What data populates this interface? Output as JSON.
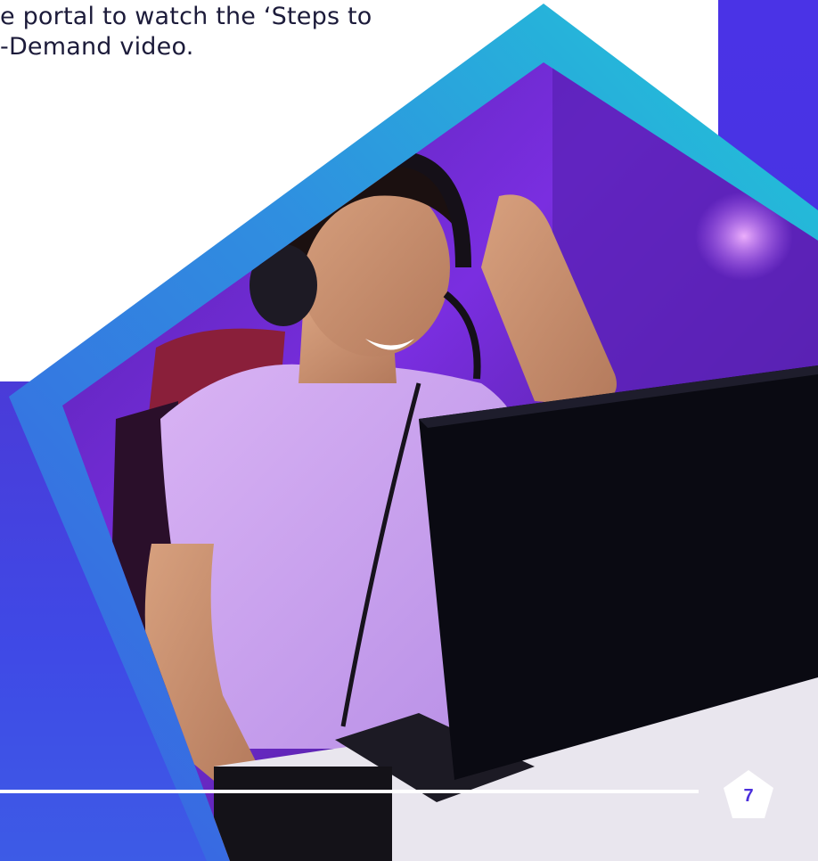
{
  "body_text": {
    "line1": "e portal to watch the ‘Steps to",
    "line2": "-Demand video."
  },
  "page_number": "7",
  "colors": {
    "accent_purple": "#4a33e6",
    "frame_cyan": "#21c6d6",
    "frame_blue": "#3b6be0",
    "page_number_color": "#4b2fdc"
  },
  "photo": {
    "icon": "photo-gamer-celebrating"
  }
}
